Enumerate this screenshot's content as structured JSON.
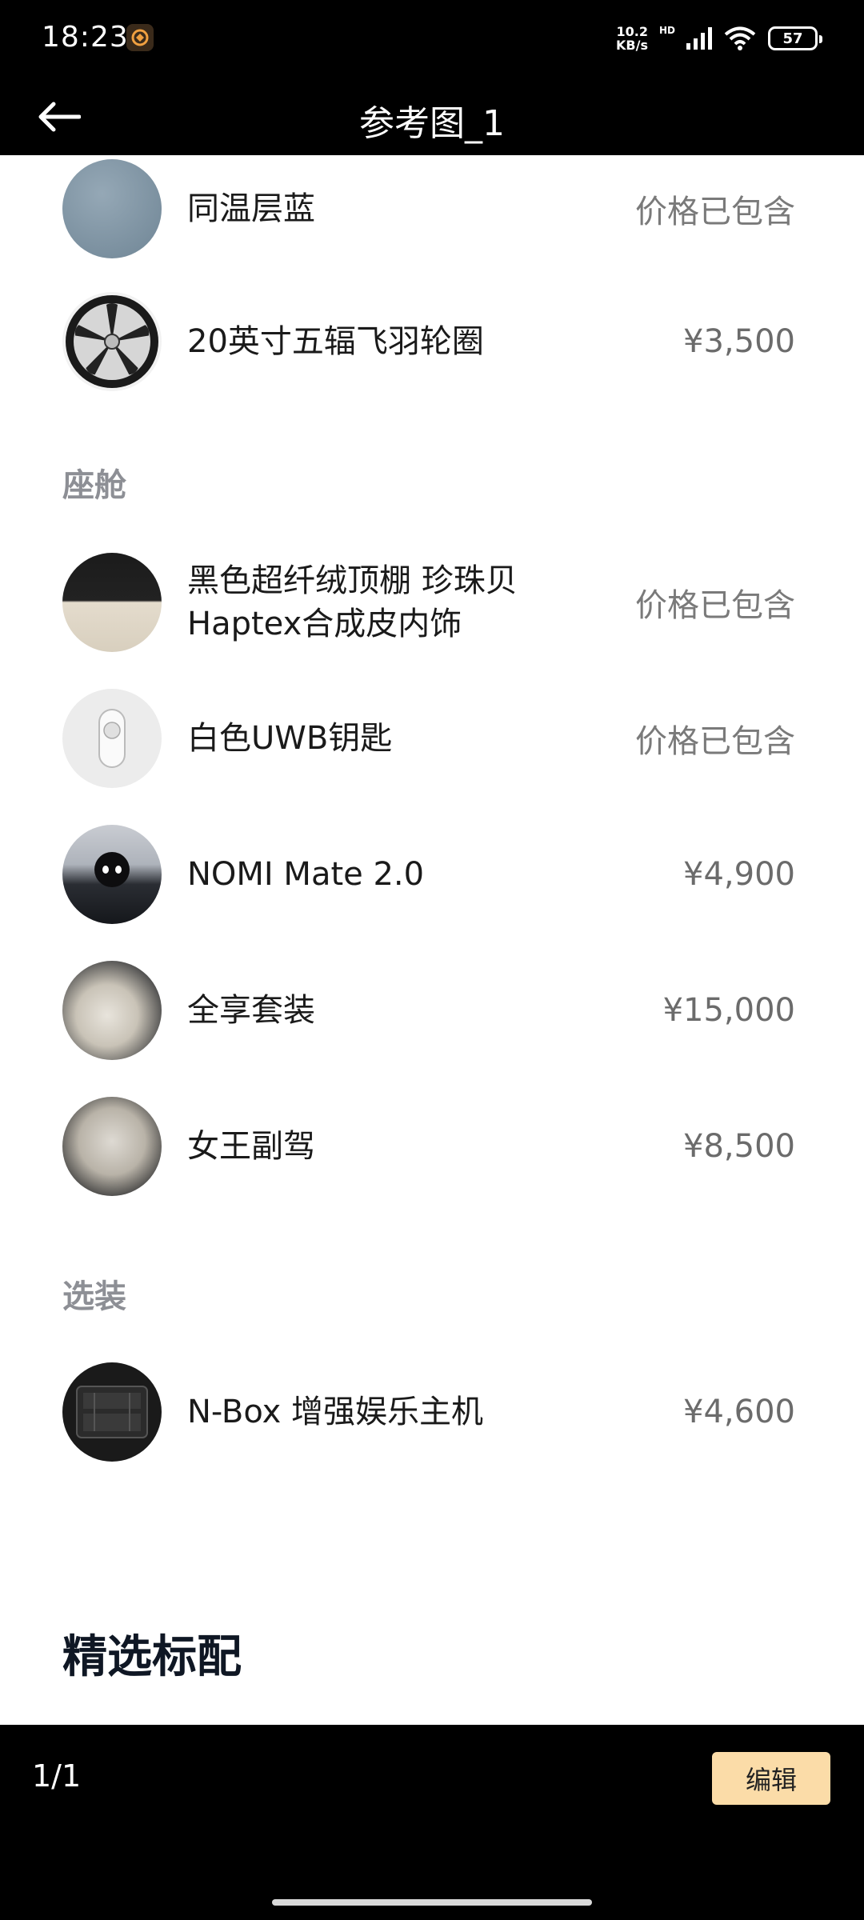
{
  "status_bar": {
    "time": "18:23",
    "net_speed_value": "10.2",
    "net_speed_unit": "KB/s",
    "network_label": "HD",
    "battery": "57"
  },
  "header": {
    "title": "参考图_1",
    "back_icon": "arrow-left-icon"
  },
  "exterior_items": [
    {
      "name": "同温层蓝",
      "price": "价格已包含",
      "thumb_color": "#7f93a3"
    },
    {
      "name": "20英寸五辐飞羽轮圈",
      "price": "¥3,500",
      "thumb_color": "#e6e6e6"
    }
  ],
  "cabin": {
    "section_title": "座舱",
    "items": [
      {
        "name_line1": "黑色超纤绒顶棚 珍珠贝",
        "name_line2": "Haptex合成皮内饰",
        "price": "价格已包含"
      },
      {
        "name": "白色UWB钥匙",
        "price": "价格已包含"
      },
      {
        "name": "NOMI Mate 2.0",
        "price": "¥4,900"
      },
      {
        "name": "全享套装",
        "price": "¥15,000"
      },
      {
        "name": "女王副驾",
        "price": "¥8,500"
      }
    ]
  },
  "options": {
    "section_title": "选装",
    "items": [
      {
        "name": "N-Box 增强娱乐主机",
        "price": "¥4,600"
      }
    ]
  },
  "featured": {
    "title": "精选标配"
  },
  "footer": {
    "page_indicator": "1/1",
    "edit_label": "编辑"
  },
  "colors": {
    "accent_button": "#fbdca8",
    "price_gray": "#6b6b6b",
    "section_gray": "#8d8f95"
  }
}
